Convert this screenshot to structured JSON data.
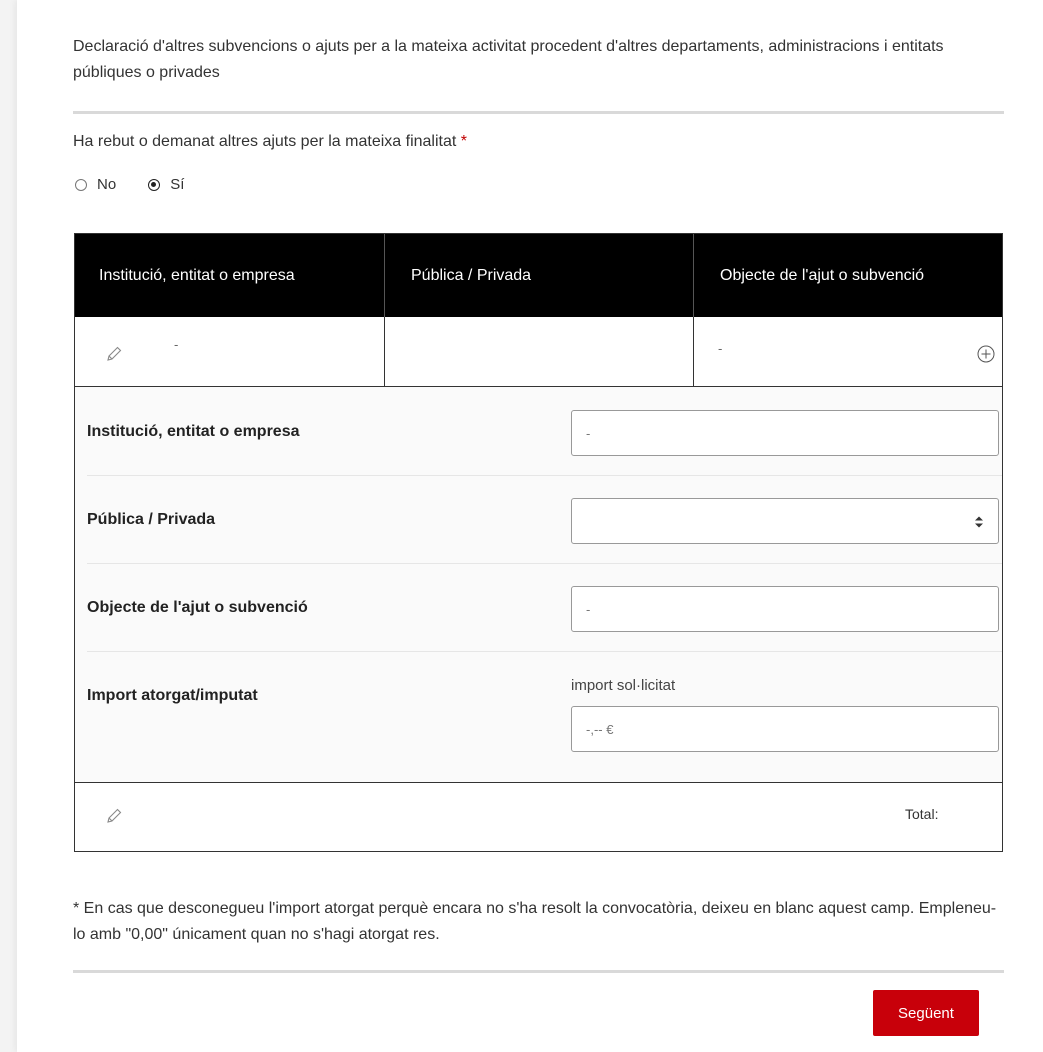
{
  "intro": {
    "text": "Declaració d'altres subvencions o ajuts per a la mateixa activitat procedent d'altres departaments, administracions i entitats públiques o privades"
  },
  "question": {
    "label": "Ha rebut o demanat altres ajuts per la mateixa finalitat",
    "required_mark": "*",
    "options": [
      {
        "label": "No",
        "selected": false
      },
      {
        "label": "Sí",
        "selected": true
      }
    ]
  },
  "table": {
    "headers": [
      "Institució, entitat o empresa",
      "Pública / Privada",
      "Objecte de l'ajut o subvenció"
    ],
    "row": {
      "col1": "-",
      "col2": "",
      "col3": "-"
    },
    "icons": {
      "edit": "pencil-icon",
      "add": "plus-circle-icon"
    }
  },
  "detail": {
    "institution": {
      "label": "Institució, entitat o empresa",
      "value": "-"
    },
    "type": {
      "label": "Pública / Privada",
      "value": ""
    },
    "object": {
      "label": "Objecte de l'ajut o subvenció",
      "value": "-"
    },
    "amount": {
      "label": "Import atorgat/imputat",
      "sublabel": "import sol·licitat",
      "value": "-,-- €"
    }
  },
  "total": {
    "label": "Total:"
  },
  "note": {
    "text": "* En cas que desconegueu l'import atorgat perquè encara no s'ha resolt la convocatòria, deixeu en blanc aquest camp. Empleneu-lo amb \"0,00\" únicament quan no s'hagi atorgat res."
  },
  "actions": {
    "next_label": "Següent"
  },
  "colors": {
    "accent": "#c8000a",
    "header_bg": "#000000"
  }
}
